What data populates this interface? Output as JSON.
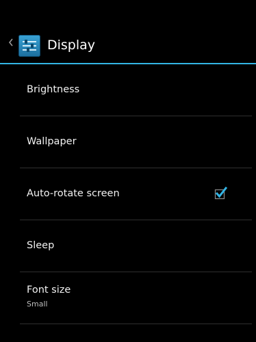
{
  "action_bar": {
    "title": "Display",
    "up_icon": "chevron-left-icon",
    "app_icon": "settings-sliders-icon",
    "accent_color": "#33b5e5"
  },
  "settings": {
    "items": [
      {
        "label": "Brightness"
      },
      {
        "label": "Wallpaper"
      },
      {
        "label": "Auto-rotate screen",
        "checked": true
      },
      {
        "label": "Sleep"
      },
      {
        "label": "Font size",
        "summary": "Small"
      }
    ]
  }
}
